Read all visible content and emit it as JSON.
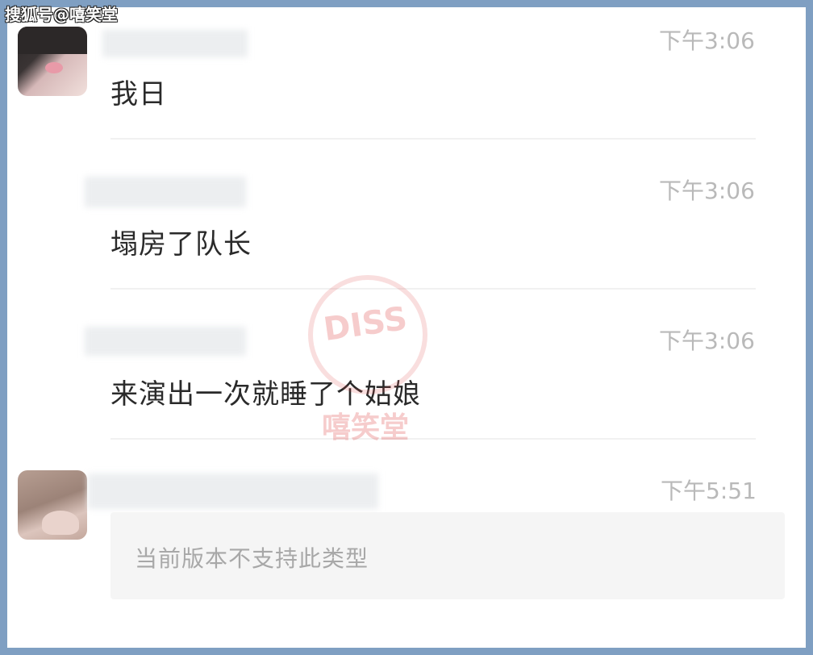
{
  "source_tag": "搜狐号@嘻笑堂",
  "watermark": {
    "logo_text": "DISS",
    "name": "嘻笑堂",
    "color": "#e04848"
  },
  "messages": [
    {
      "time": "下午3:06",
      "text": "我日"
    },
    {
      "time": "下午3:06",
      "text": "塌房了队长"
    },
    {
      "time": "下午3:06",
      "text": "来演出一次就睡了个姑娘"
    },
    {
      "time": "下午5:51",
      "text": "当前版本不支持此类型"
    }
  ],
  "colors": {
    "page_border": "#7f9fc2",
    "message_text": "#2a2a2a",
    "timestamp": "#b9b9b9",
    "unsupported_text": "#a8a8a8"
  }
}
